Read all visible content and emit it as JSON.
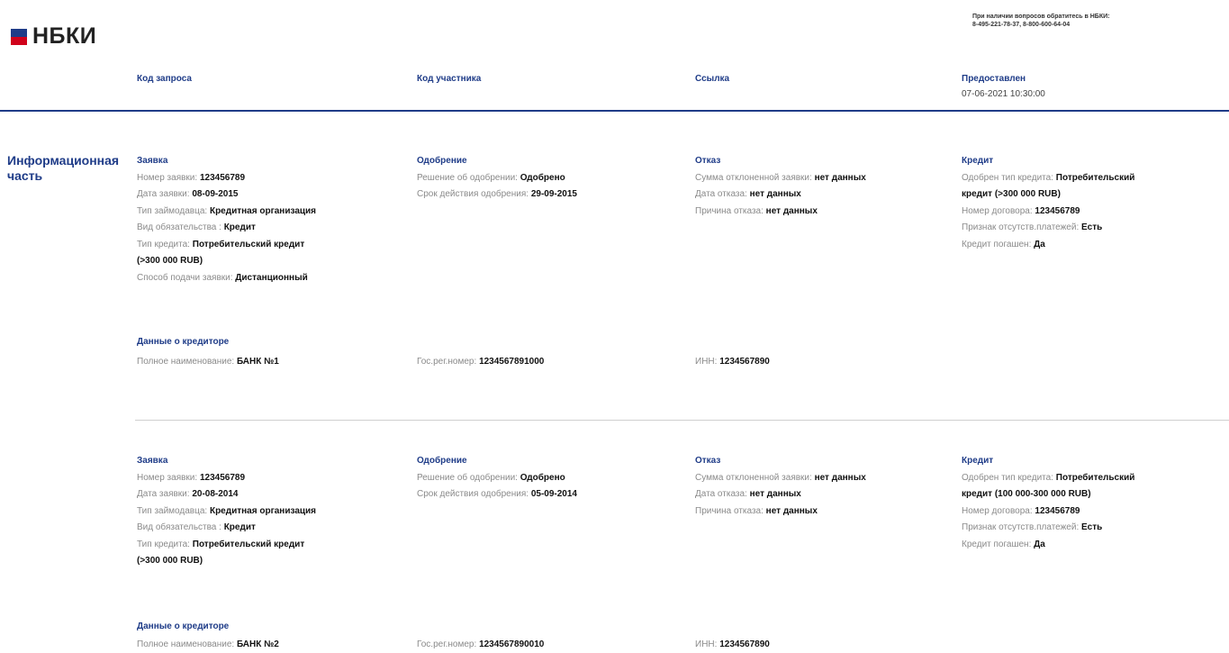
{
  "logo": {
    "text": "НБКИ",
    "colors": [
      "#1f3c88",
      "#d0021b"
    ]
  },
  "contact": {
    "line1": "При наличии вопросов обратитесь в НБКИ:",
    "line2": "8-495-221-78-37, 8-800-600-64-04"
  },
  "header": {
    "query_code": "Код запроса",
    "participant_code": "Код участника",
    "link": "Ссылка",
    "provided_label": "Предоставлен",
    "provided_value": "07-06-2021 10:30:00"
  },
  "section_title": "Информационная часть",
  "records": [
    {
      "application": {
        "title": "Заявка",
        "rows": [
          {
            "label": "Номер заявки:",
            "value": "123456789"
          },
          {
            "label": "Дата заявки:",
            "value": "08-09-2015"
          },
          {
            "label": "Тип займодавца:",
            "value": "Кредитная организация"
          },
          {
            "label": "Вид обязательства :",
            "value": "Кредит"
          },
          {
            "label": "Тип кредита:",
            "value": "Потребительский кредит"
          },
          {
            "label": "",
            "value": "(>300 000 RUB)"
          },
          {
            "label": "Способ подачи заявки:",
            "value": "Дистанционный"
          }
        ]
      },
      "approval": {
        "title": "Одобрение",
        "rows": [
          {
            "label": "Решение об одобрении:",
            "value": "Одобрено"
          },
          {
            "label": "Срок действия одобрения:",
            "value": "29-09-2015"
          }
        ]
      },
      "refusal": {
        "title": "Отказ",
        "rows": [
          {
            "label": "Сумма отклоненной заявки:",
            "value": "нет данных"
          },
          {
            "label": "Дата отказа:",
            "value": "нет данных"
          },
          {
            "label": "Причина отказа:",
            "value": "нет данных"
          }
        ]
      },
      "credit": {
        "title": "Кредит",
        "rows": [
          {
            "label": "Одобрен тип кредита:",
            "value": "Потребительский"
          },
          {
            "label": "",
            "value": "кредит (>300 000 RUB)"
          },
          {
            "label": "Номер договора:",
            "value": "123456789"
          },
          {
            "label": "Признак отсутств.платежей:",
            "value": "Есть"
          },
          {
            "label": "Кредит погашен:",
            "value": "Да"
          }
        ]
      },
      "creditor": {
        "title": "Данные о кредиторе",
        "full_name_label": "Полное наименование:",
        "full_name_value": "БАНК №1",
        "reg_label": "Гос.рег.номер:",
        "reg_value": "1234567891000",
        "inn_label": "ИНН:",
        "inn_value": "1234567890"
      }
    },
    {
      "application": {
        "title": "Заявка",
        "rows": [
          {
            "label": "Номер заявки:",
            "value": "123456789"
          },
          {
            "label": "Дата заявки:",
            "value": "20-08-2014"
          },
          {
            "label": "Тип займодавца:",
            "value": "Кредитная организация"
          },
          {
            "label": "Вид обязательства :",
            "value": "Кредит"
          },
          {
            "label": "Тип кредита:",
            "value": "Потребительский кредит"
          },
          {
            "label": "",
            "value": "(>300 000 RUB)"
          }
        ]
      },
      "approval": {
        "title": "Одобрение",
        "rows": [
          {
            "label": "Решение об одобрении:",
            "value": "Одобрено"
          },
          {
            "label": "Срок действия одобрения:",
            "value": "05-09-2014"
          }
        ]
      },
      "refusal": {
        "title": "Отказ",
        "rows": [
          {
            "label": "Сумма отклоненной заявки:",
            "value": "нет данных"
          },
          {
            "label": "Дата отказа:",
            "value": "нет данных"
          },
          {
            "label": "Причина отказа:",
            "value": "нет данных"
          }
        ]
      },
      "credit": {
        "title": "Кредит",
        "rows": [
          {
            "label": "Одобрен тип кредита:",
            "value": "Потребительский"
          },
          {
            "label": "",
            "value": "кредит (100 000-300 000 RUB)"
          },
          {
            "label": "Номер договора:",
            "value": "123456789"
          },
          {
            "label": "Признак отсутств.платежей:",
            "value": "Есть"
          },
          {
            "label": "Кредит погашен:",
            "value": "Да"
          }
        ]
      },
      "creditor": {
        "title": "Данные о кредиторе",
        "full_name_label": "Полное наименование:",
        "full_name_value": "БАНК №2",
        "reg_label": "Гос.рег.номер:",
        "reg_value": "1234567890010",
        "inn_label": "ИНН:",
        "inn_value": "1234567890"
      }
    }
  ]
}
